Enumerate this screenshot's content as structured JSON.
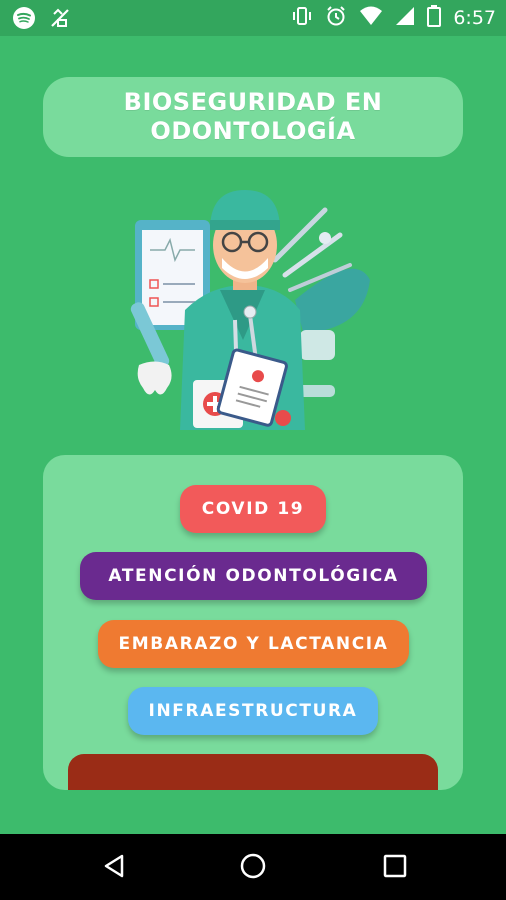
{
  "status_bar": {
    "time": "6:57",
    "icons_left": [
      "spotify-icon",
      "no-sim-icon"
    ],
    "icons_right": [
      "vibrate-icon",
      "alarm-icon",
      "wifi-icon",
      "signal-icon",
      "battery-icon"
    ]
  },
  "header": {
    "title_line1": "BIOSEGURIDAD EN",
    "title_line2": "ODONTOLOGÍA"
  },
  "illustration": {
    "subject": "dentist-illustration"
  },
  "menu": {
    "items": [
      {
        "label": "COVID 19",
        "color": "#f25a5a"
      },
      {
        "label": "ATENCIÓN ODONTOLÓGICA",
        "color": "#6a2a8f"
      },
      {
        "label": "EMBARAZO Y LACTANCIA",
        "color": "#ef7a31"
      },
      {
        "label": "INFRAESTRUCTURA",
        "color": "#5bb7f0"
      }
    ],
    "partial_item_color": "#9a2c16"
  },
  "nav_bar": {
    "buttons": [
      "back-icon",
      "home-icon",
      "recents-icon"
    ]
  },
  "colors": {
    "background": "#3dbb6c",
    "card": "#79db9c",
    "status_bar": "#33a65d"
  }
}
